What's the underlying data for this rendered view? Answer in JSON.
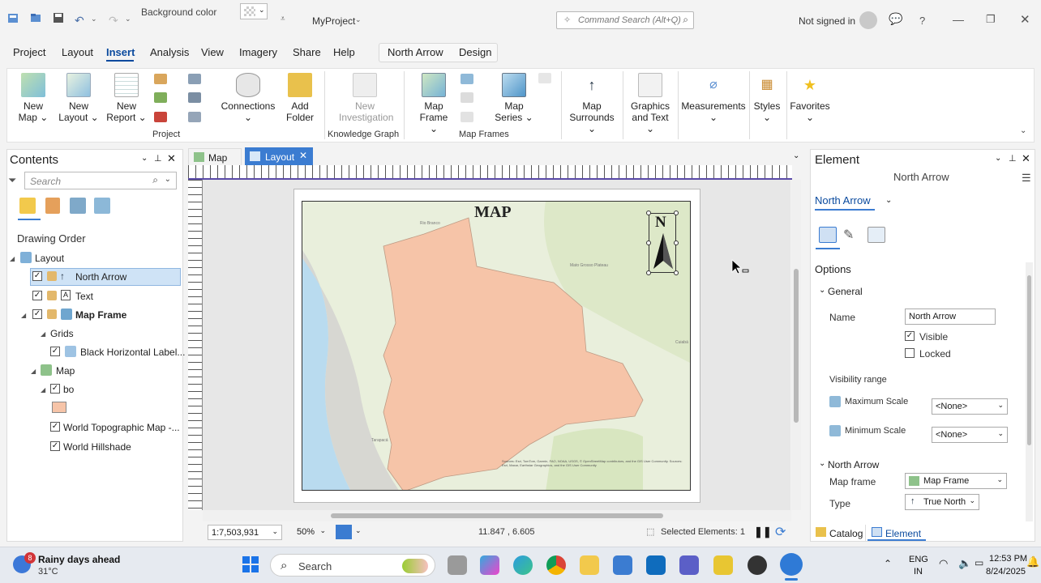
{
  "titlebar": {
    "background_color_label": "Background color",
    "project_name": "MyProject",
    "command_search_placeholder": "Command Search (Alt+Q)",
    "signin_status": "Not signed in"
  },
  "menu": {
    "tabs": [
      "Project",
      "Layout",
      "Insert",
      "Analysis",
      "View",
      "Imagery",
      "Share",
      "Help"
    ],
    "active": "Insert",
    "contextual_tabs": [
      "North Arrow",
      "Design"
    ]
  },
  "ribbon": {
    "new_map": [
      "New",
      "Map"
    ],
    "new_layout": [
      "New",
      "Layout"
    ],
    "new_report": [
      "New",
      "Report"
    ],
    "connections": "Connections",
    "add_folder": [
      "Add",
      "Folder"
    ],
    "group_project": "Project",
    "new_investigation": [
      "New",
      "Investigation"
    ],
    "group_knowledge_graph": "Knowledge Graph",
    "map_frame": [
      "Map",
      "Frame"
    ],
    "map_series": [
      "Map",
      "Series"
    ],
    "group_map_frames": "Map Frames",
    "map_surrounds": [
      "Map",
      "Surrounds"
    ],
    "graphics_text": [
      "Graphics",
      "and Text"
    ],
    "measurements": "Measurements",
    "styles": "Styles",
    "favorites": "Favorites"
  },
  "contents": {
    "title": "Contents",
    "search_placeholder": "Search",
    "drawing_order": "Drawing Order",
    "tree": {
      "layout": "Layout",
      "north_arrow": "North Arrow",
      "text": "Text",
      "map_frame": "Map Frame",
      "grids": "Grids",
      "black_horizontal": "Black Horizontal Label...",
      "map": "Map",
      "bo": "bo",
      "world_topo": "World Topographic Map -...",
      "world_hillshade": "World Hillshade"
    },
    "bo_fill_color": "#f6c4a8"
  },
  "view_tabs": {
    "map": "Map",
    "layout": "Layout"
  },
  "layout_page": {
    "map_title": "MAP",
    "north_letter": "N",
    "attribution": "Sources: Esri, TomTom, Garmin, FAO, NOAA, USGS, © OpenStreetMap contributors, and the GIS User Community. Sources: Esri, Maxar, Earthstar Geographics, and the GIS User Community"
  },
  "status": {
    "scale": "1:7,503,931",
    "zoom": "50%",
    "coords": "11.847 , 6.605",
    "selected": "Selected Elements: 1"
  },
  "element": {
    "title": "Element",
    "subtitle": "North Arrow",
    "dropdown": "North Arrow",
    "options": "Options",
    "general": "General",
    "name_label": "Name",
    "name_value": "North Arrow",
    "visible": "Visible",
    "locked": "Locked",
    "visibility_range": "Visibility range",
    "max_scale": "Maximum Scale",
    "min_scale": "Minimum Scale",
    "none_value": "<None>",
    "north_arrow_section": "North Arrow",
    "map_frame_label": "Map frame",
    "map_frame_value": "Map Frame",
    "type_label": "Type",
    "type_value": "True North",
    "catalog_tab": "Catalog",
    "element_tab": "Element"
  },
  "taskbar": {
    "weather_badge": "8",
    "weather_text": "Rainy days ahead",
    "temperature": "31°C",
    "search": "Search",
    "lang1": "ENG",
    "lang2": "IN",
    "time": "12:53 PM",
    "date": "8/24/2025"
  }
}
